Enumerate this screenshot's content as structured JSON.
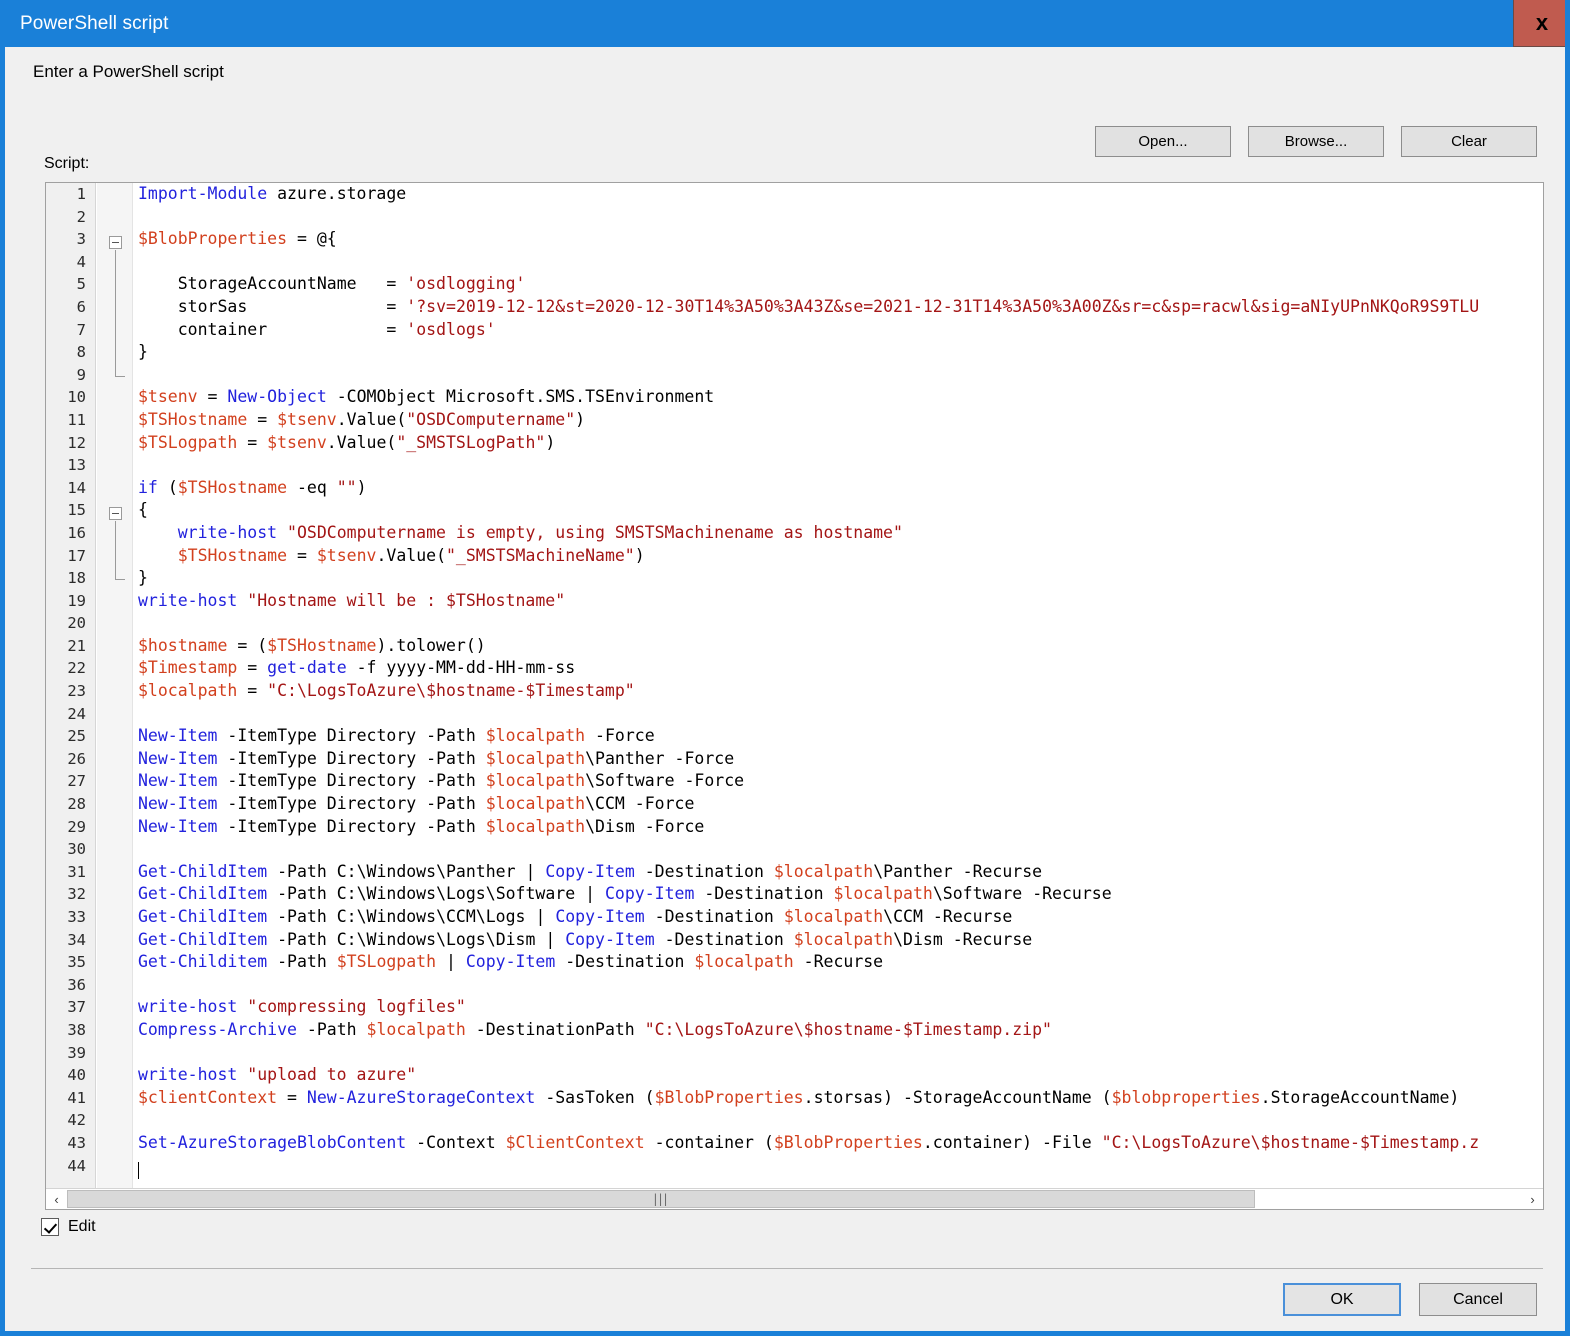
{
  "window": {
    "title": "PowerShell script",
    "close_icon": "close-icon",
    "close_label": "x",
    "accent_color": "#1a80d8",
    "close_color": "#c05b4f"
  },
  "instruction": "Enter a PowerShell script",
  "toolbar": {
    "open_label": "Open...",
    "browse_label": "Browse...",
    "clear_label": "Clear"
  },
  "script_label": "Script:",
  "editor": {
    "lines": [
      {
        "n": "1",
        "text": "Import-Module azure.storage"
      },
      {
        "n": "2",
        "text": ""
      },
      {
        "n": "3",
        "text": "$BlobProperties = @{"
      },
      {
        "n": "4",
        "text": ""
      },
      {
        "n": "5",
        "text": "    StorageAccountName   = 'osdlogging'"
      },
      {
        "n": "6",
        "text": "    storSas              = '?sv=2019-12-12&st=2020-12-30T14%3A50%3A43Z&se=2021-12-31T14%3A50%3A00Z&sr=c&sp=racwl&sig=aNIyUPnNKQoR9S9TLU"
      },
      {
        "n": "7",
        "text": "    container            = 'osdlogs'"
      },
      {
        "n": "8",
        "text": "}"
      },
      {
        "n": "9",
        "text": ""
      },
      {
        "n": "10",
        "text": "$tsenv = New-Object -COMObject Microsoft.SMS.TSEnvironment"
      },
      {
        "n": "11",
        "text": "$TSHostname = $tsenv.Value(\"OSDComputername\")"
      },
      {
        "n": "12",
        "text": "$TSLogpath = $tsenv.Value(\"_SMSTSLogPath\")"
      },
      {
        "n": "13",
        "text": ""
      },
      {
        "n": "14",
        "text": "if ($TSHostname -eq \"\")"
      },
      {
        "n": "15",
        "text": "{"
      },
      {
        "n": "16",
        "text": "    write-host \"OSDComputername is empty, using SMSTSMachinename as hostname\""
      },
      {
        "n": "17",
        "text": "    $TSHostname = $tsenv.Value(\"_SMSTSMachineName\")"
      },
      {
        "n": "18",
        "text": "}"
      },
      {
        "n": "19",
        "text": "write-host \"Hostname will be : $TSHostname\""
      },
      {
        "n": "20",
        "text": ""
      },
      {
        "n": "21",
        "text": "$hostname = ($TSHostname).tolower()"
      },
      {
        "n": "22",
        "text": "$Timestamp = get-date -f yyyy-MM-dd-HH-mm-ss"
      },
      {
        "n": "23",
        "text": "$localpath = \"C:\\LogsToAzure\\$hostname-$Timestamp\""
      },
      {
        "n": "24",
        "text": ""
      },
      {
        "n": "25",
        "text": "New-Item -ItemType Directory -Path $localpath -Force"
      },
      {
        "n": "26",
        "text": "New-Item -ItemType Directory -Path $localpath\\Panther -Force"
      },
      {
        "n": "27",
        "text": "New-Item -ItemType Directory -Path $localpath\\Software -Force"
      },
      {
        "n": "28",
        "text": "New-Item -ItemType Directory -Path $localpath\\CCM -Force"
      },
      {
        "n": "29",
        "text": "New-Item -ItemType Directory -Path $localpath\\Dism -Force"
      },
      {
        "n": "30",
        "text": ""
      },
      {
        "n": "31",
        "text": "Get-ChildItem -Path C:\\Windows\\Panther | Copy-Item -Destination $localpath\\Panther -Recurse"
      },
      {
        "n": "32",
        "text": "Get-ChildItem -Path C:\\Windows\\Logs\\Software | Copy-Item -Destination $localpath\\Software -Recurse"
      },
      {
        "n": "33",
        "text": "Get-ChildItem -Path C:\\Windows\\CCM\\Logs | Copy-Item -Destination $localpath\\CCM -Recurse"
      },
      {
        "n": "34",
        "text": "Get-ChildItem -Path C:\\Windows\\Logs\\Dism | Copy-Item -Destination $localpath\\Dism -Recurse"
      },
      {
        "n": "35",
        "text": "Get-Childitem -Path $TSLogpath | Copy-Item -Destination $localpath -Recurse"
      },
      {
        "n": "36",
        "text": ""
      },
      {
        "n": "37",
        "text": "write-host \"compressing logfiles\""
      },
      {
        "n": "38",
        "text": "Compress-Archive -Path $localpath -DestinationPath \"C:\\LogsToAzure\\$hostname-$Timestamp.zip\""
      },
      {
        "n": "39",
        "text": ""
      },
      {
        "n": "40",
        "text": "write-host \"upload to azure\""
      },
      {
        "n": "41",
        "text": "$clientContext = New-AzureStorageContext -SasToken ($BlobProperties.storsas) -StorageAccountName ($blobproperties.StorageAccountName)"
      },
      {
        "n": "42",
        "text": ""
      },
      {
        "n": "43",
        "text": "Set-AzureStorageBlobContent -Context $ClientContext -container ($BlobProperties.container) -File \"C:\\LogsToAzure\\$hostname-$Timestamp.z"
      },
      {
        "n": "44",
        "text": ""
      }
    ],
    "colors": {
      "cmdlet": "#2222dd",
      "variable": "#d2401e",
      "string": "#a31515",
      "plain": "#000000",
      "gutter_bg": "#f0f0f0",
      "background": "#ffffff"
    }
  },
  "scrollbar": {
    "left_arrow": "‹",
    "right_arrow": "›",
    "grip": "⦀"
  },
  "edit_checkbox": {
    "label": "Edit",
    "checked": true
  },
  "footer": {
    "ok_label": "OK",
    "cancel_label": "Cancel"
  }
}
